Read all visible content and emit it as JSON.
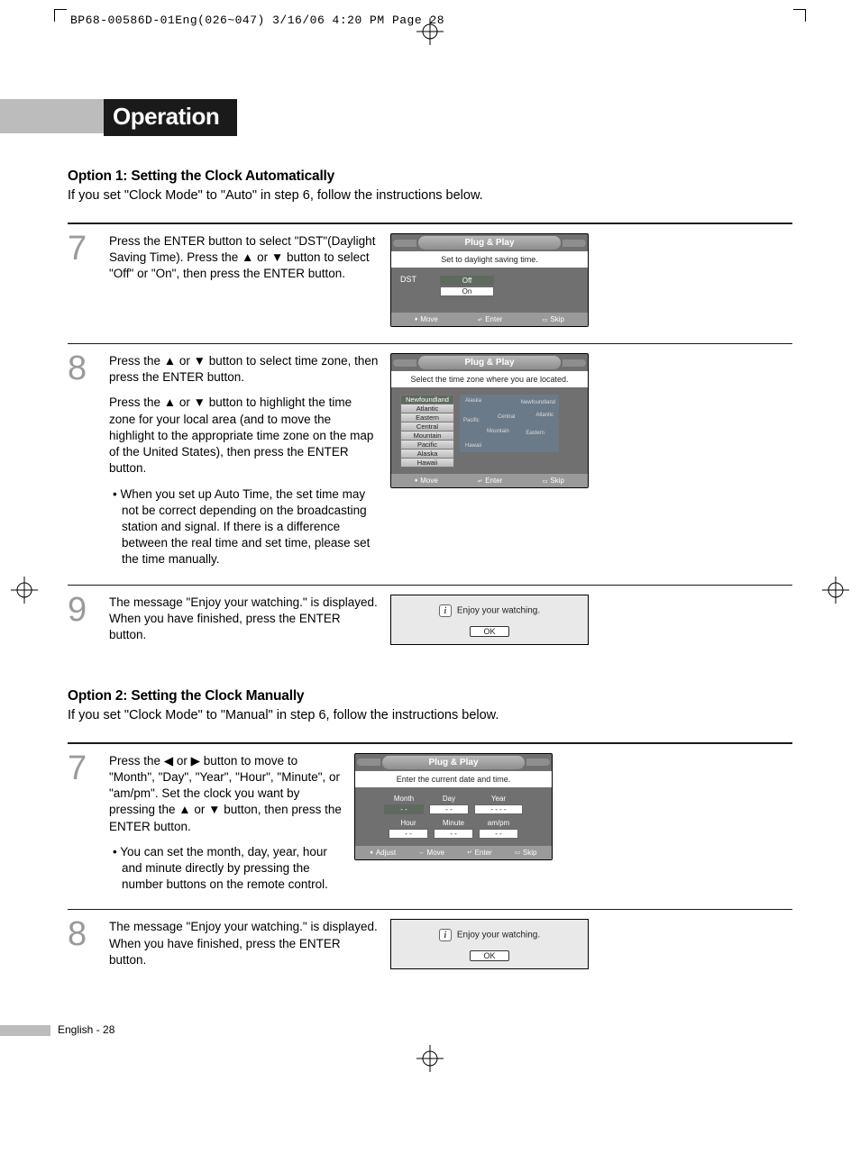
{
  "job_line": "BP68-00586D-01Eng(026~047)  3/16/06  4:20 PM  Page 28",
  "section_title": "Operation",
  "option1": {
    "heading": "Option 1: Setting the Clock Automatically",
    "lead": "If you set \"Clock Mode\" to \"Auto\" in step 6, follow the instructions below."
  },
  "option2": {
    "heading": "Option 2: Setting the Clock Manually",
    "lead": "If you set \"Clock Mode\" to \"Manual\" in step 6, follow the instructions below."
  },
  "steps": {
    "s7a": {
      "num": "7",
      "text": "Press the ENTER button to select \"DST\"(Daylight Saving Time). Press the ▲ or ▼ button to select \"Off\" or \"On\", then press the ENTER button."
    },
    "s8a": {
      "num": "8",
      "text1": "Press the ▲ or ▼ button to select time zone, then press the ENTER button.",
      "text2": "Press the ▲ or ▼ button to highlight the time zone for your local area (and to move the highlight to the appropriate time zone on the map of the United States), then press the ENTER button.",
      "bullet": "When you set up Auto Time, the set time may not be correct depending on the broadcasting station and signal. If there is a difference between the real time and set time, please set the time manually."
    },
    "s9a": {
      "num": "9",
      "text": "The message \"Enjoy your watching.\" is displayed. When you have finished, press the ENTER button."
    },
    "s7b": {
      "num": "7",
      "text": "Press the ◀ or ▶ button to move to \"Month\", \"Day\", \"Year\", \"Hour\", \"Minute\", or \"am/pm\". Set the clock you want by pressing the ▲ or ▼ button, then press the ENTER button.",
      "bullet": "You can set the month, day, year, hour and minute directly by pressing the number buttons on the remote control."
    },
    "s8b": {
      "num": "8",
      "text": "The message \"Enjoy your watching.\" is displayed. When you have finished, press the ENTER button."
    }
  },
  "osd": {
    "title": "Plug & Play",
    "dst_prompt": "Set to daylight saving time.",
    "dst_label": "DST",
    "dst_off": "Off",
    "dst_on": "On",
    "tz_prompt": "Select the time zone where you are located.",
    "tz_items": [
      "Newfoundland",
      "Atlantic",
      "Eastern",
      "Central",
      "Mountain",
      "Pacific",
      "Alaska",
      "Hawaii"
    ],
    "map_labels": [
      "Alaska",
      "Pacific",
      "Central",
      "Atlantic",
      "Newfoundland",
      "Mountain",
      "Eastern",
      "Hawaii"
    ],
    "dt_prompt": "Enter the current date and time.",
    "dt_labels": {
      "month": "Month",
      "day": "Day",
      "year": "Year",
      "hour": "Hour",
      "minute": "Minute",
      "ampm": "am/pm"
    },
    "dt_placeholder": "- -",
    "dt_placeholder_year": "- - - -",
    "footer_move": "Move",
    "footer_enter": "Enter",
    "footer_skip": "Skip",
    "footer_adjust": "Adjust"
  },
  "msg": {
    "text": "Enjoy your watching.",
    "ok": "OK"
  },
  "page_footer": "English - 28"
}
